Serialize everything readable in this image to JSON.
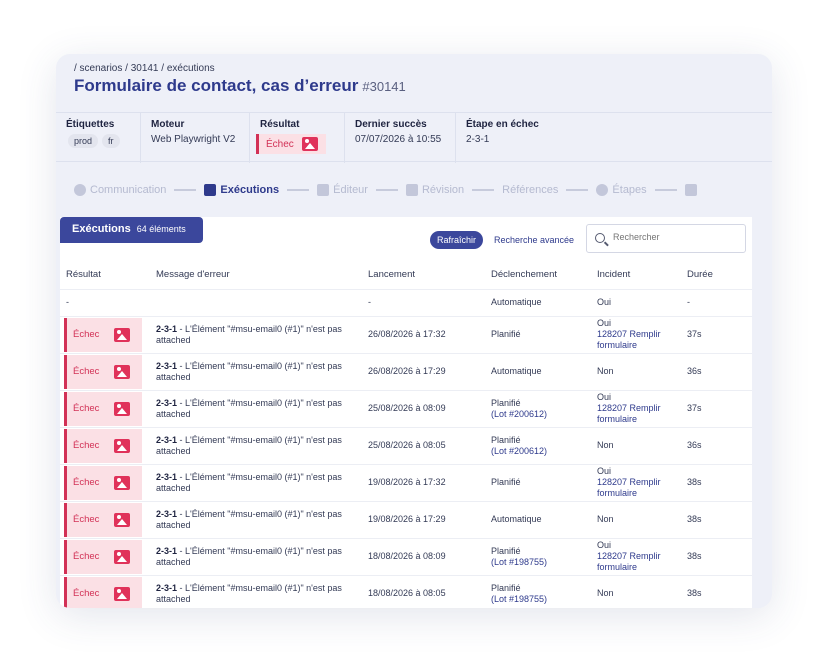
{
  "breadcrumb": "/ scenarios / 30141 / exécutions",
  "title": "Formulaire de contact, cas d’erreur",
  "title_id": "#30141",
  "meta": {
    "etiquettes_label": "Étiquettes",
    "tags": [
      "prod",
      "fr"
    ],
    "moteur_label": "Moteur",
    "moteur_value": "Web Playwright V2",
    "resultat_label": "Résultat",
    "resultat_value": "Échec",
    "dernier_succes_label": "Dernier succès",
    "dernier_succes_value": "07/07/2026 à 10:55",
    "etape_echec_label": "Étape en échec",
    "etape_echec_value": "2-3-1"
  },
  "steps": [
    {
      "label": "Communication",
      "icon": "eye-icon",
      "active": false
    },
    {
      "label": "Exécutions",
      "icon": "document-icon",
      "active": true
    },
    {
      "label": "Éditeur",
      "icon": "pencil-icon",
      "active": false
    },
    {
      "label": "Révision",
      "icon": "document-icon",
      "active": false
    },
    {
      "label": "Références",
      "icon": "",
      "active": false
    },
    {
      "label": "Étapes",
      "icon": "eye-icon",
      "active": false
    }
  ],
  "panel": {
    "tab_label": "Exécutions",
    "tab_count": "64 éléments",
    "refresh_label": "Rafraîchir",
    "advanced_search_label": "Recherche avancée",
    "search_placeholder": "Rechercher"
  },
  "table": {
    "headers": [
      "Résultat",
      "Message d'erreur",
      "Lancement",
      "Déclenchement",
      "Incident",
      "Durée"
    ],
    "first_row": {
      "resultat": "-",
      "message": "",
      "lancement": "-",
      "declenchement": "Automatique",
      "incident": "Oui",
      "duree": "-"
    },
    "rows": [
      {
        "resultat": "Échec",
        "msg_step": "2-3-1",
        "msg_text": " - L'Élément \"#msu-email0 (#1)\" n'est pas attached",
        "lancement": "26/08/2026 à 17:32",
        "decl_main": "Planifié",
        "decl_lot": "",
        "inc_main": "Oui",
        "inc_link": "128207 Remplir formulaire",
        "duree": "37s"
      },
      {
        "resultat": "Échec",
        "msg_step": "2-3-1",
        "msg_text": " - L'Élément \"#msu-email0 (#1)\" n'est pas attached",
        "lancement": "26/08/2026 à 17:29",
        "decl_main": "Automatique",
        "decl_lot": "",
        "inc_main": "Non",
        "inc_link": "",
        "duree": "36s"
      },
      {
        "resultat": "Échec",
        "msg_step": "2-3-1",
        "msg_text": " - L'Élément \"#msu-email0 (#1)\" n'est pas attached",
        "lancement": "25/08/2026 à 08:09",
        "decl_main": "Planifié",
        "decl_lot": "(Lot #200612)",
        "inc_main": "Oui",
        "inc_link": "128207 Remplir formulaire",
        "duree": "37s"
      },
      {
        "resultat": "Échec",
        "msg_step": "2-3-1",
        "msg_text": " - L'Élément \"#msu-email0 (#1)\" n'est pas attached",
        "lancement": "25/08/2026 à 08:05",
        "decl_main": "Planifié",
        "decl_lot": "(Lot #200612)",
        "inc_main": "Non",
        "inc_link": "",
        "duree": "36s"
      },
      {
        "resultat": "Échec",
        "msg_step": "2-3-1",
        "msg_text": " - L'Élément \"#msu-email0 (#1)\" n'est pas attached",
        "lancement": "19/08/2026 à 17:32",
        "decl_main": "Planifié",
        "decl_lot": "",
        "inc_main": "Oui",
        "inc_link": "128207 Remplir formulaire",
        "duree": "38s"
      },
      {
        "resultat": "Échec",
        "msg_step": "2-3-1",
        "msg_text": " - L'Élément \"#msu-email0 (#1)\" n'est pas attached",
        "lancement": "19/08/2026 à 17:29",
        "decl_main": "Automatique",
        "decl_lot": "",
        "inc_main": "Non",
        "inc_link": "",
        "duree": "38s"
      },
      {
        "resultat": "Échec",
        "msg_step": "2-3-1",
        "msg_text": " - L'Élément \"#msu-email0 (#1)\" n'est pas attached",
        "lancement": "18/08/2026 à 08:09",
        "decl_main": "Planifié",
        "decl_lot": "(Lot #198755)",
        "inc_main": "Oui",
        "inc_link": "128207 Remplir formulaire",
        "duree": "38s"
      },
      {
        "resultat": "Échec",
        "msg_step": "2-3-1",
        "msg_text": " - L'Élément \"#msu-email0 (#1)\" n'est pas attached",
        "lancement": "18/08/2026 à 08:05",
        "decl_main": "Planifié",
        "decl_lot": "(Lot #198755)",
        "inc_main": "Non",
        "inc_link": "",
        "duree": "38s"
      }
    ]
  },
  "colors": {
    "primary": "#3b479c",
    "title": "#2e3a8c",
    "failure": "#d23156",
    "failure_bg": "#fbe0e5"
  }
}
